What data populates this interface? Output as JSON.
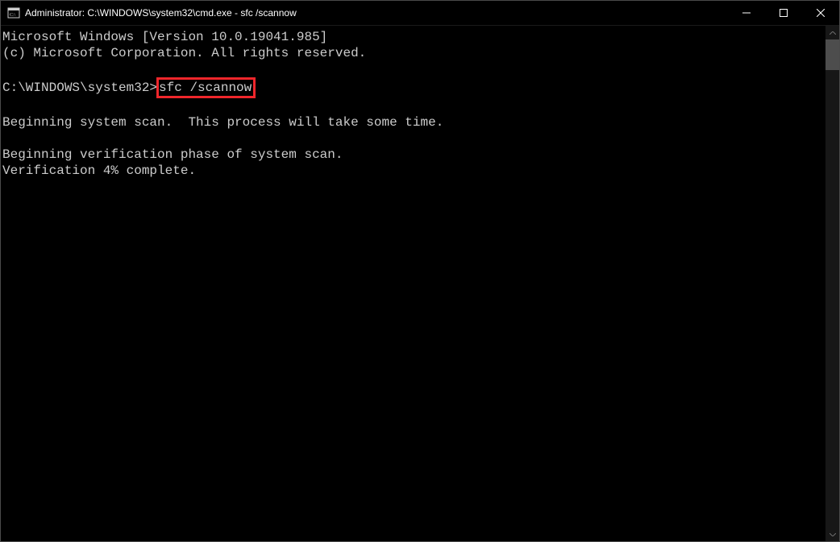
{
  "titlebar": {
    "title": "Administrator: C:\\WINDOWS\\system32\\cmd.exe - sfc  /scannow"
  },
  "terminal": {
    "line1": "Microsoft Windows [Version 10.0.19041.985]",
    "line2": "(c) Microsoft Corporation. All rights reserved.",
    "blank1": "",
    "prompt": "C:\\WINDOWS\\system32>",
    "command": "sfc /scannow",
    "blank2": "",
    "line3": "Beginning system scan.  This process will take some time.",
    "blank3": "",
    "line4": "Beginning verification phase of system scan.",
    "line5": "Verification 4% complete."
  }
}
